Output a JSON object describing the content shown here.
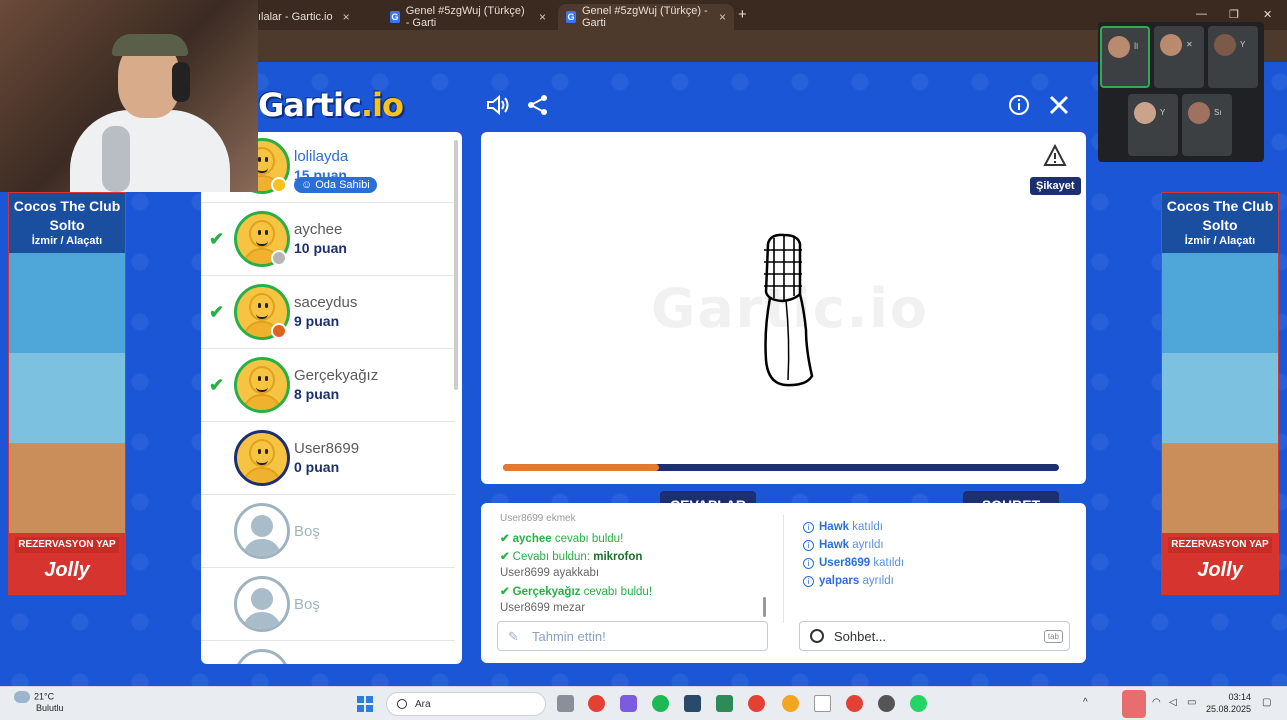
{
  "browser": {
    "tabs": [
      {
        "title": "ılalar - Gartic.io",
        "active": false
      },
      {
        "title": "Genel #5zgWuj (Türkçe) - Garti",
        "active": false
      },
      {
        "title": "Genel #5zgWuj (Türkçe) - Garti",
        "active": true
      }
    ],
    "new_tab": "+",
    "close_glyph": "×",
    "minimize": "—",
    "maximize": "❐",
    "close_window": "✕"
  },
  "header": {
    "logo_main": "Gartic",
    "logo_suffix": ".io",
    "sound_icon": "speaker-icon",
    "share_icon": "share-icon",
    "info_icon": "info-icon",
    "close_icon": "close-icon"
  },
  "players": [
    {
      "name": "lolilayda",
      "score": "15 puan",
      "badge": "Oda Sahibi",
      "guessed": false,
      "status_color": "#f7c21a",
      "style": "owner"
    },
    {
      "name": "aychee",
      "score": "10 puan",
      "guessed": true,
      "status_color": "#b5b5b5",
      "style": "normal"
    },
    {
      "name": "saceydus",
      "score": "9 puan",
      "guessed": true,
      "status_color": "#d9651e",
      "style": "normal"
    },
    {
      "name": "Gerçekyağız",
      "score": "8 puan",
      "guessed": true,
      "status_color": "",
      "style": "normal"
    },
    {
      "name": "User8699",
      "score": "0 puan",
      "guessed": false,
      "status_color": "",
      "style": "drawer"
    },
    {
      "name": "Boş",
      "score": "",
      "guessed": false,
      "status_color": "",
      "style": "empty"
    },
    {
      "name": "Boş",
      "score": "",
      "guessed": false,
      "status_color": "",
      "style": "empty"
    }
  ],
  "canvas": {
    "watermark": "Gartic.io",
    "report_icon": "warning-icon",
    "report_tooltip": "Şikayet",
    "progress": 0.28
  },
  "tabs": {
    "answers": "CEVAPLAR",
    "chat": "SOHBET"
  },
  "answers": [
    {
      "user": "User8699",
      "text": "ekmek"
    },
    {
      "user": "aychee",
      "text": "cevabı buldu!",
      "type": "found"
    },
    {
      "prefix": "Cevabı buldun:",
      "word": "mikrofon",
      "type": "you_found"
    },
    {
      "user": "User8699",
      "text": "ayakkabı"
    },
    {
      "user": "Gerçekyağız",
      "text": "cevabı buldu!",
      "type": "found"
    },
    {
      "user": "User8699",
      "text": "mezar"
    }
  ],
  "chat": [
    {
      "user": "Hawk",
      "action": "katıldı"
    },
    {
      "user": "Hawk",
      "action": "ayrıldı"
    },
    {
      "user": "User8699",
      "action": "katıldı"
    },
    {
      "user": "yalpars",
      "action": "ayrıldı"
    }
  ],
  "inputs": {
    "guess_placeholder": "Tahmin ettin!",
    "chat_placeholder": "Sohbet...",
    "chat_shortcut": "tab"
  },
  "ads": {
    "title": "Cocos The Club Solto",
    "location": "İzmir / Alaçatı",
    "cta": "REZERVASYON YAP",
    "brand": "Jolly"
  },
  "meet": {
    "tiles": [
      {
        "label": "İl"
      },
      {
        "label": ""
      },
      {
        "label": "Y"
      },
      {
        "label": "Y"
      },
      {
        "label": "Sı"
      }
    ]
  },
  "taskbar": {
    "temperature": "21°C",
    "weather": "Bulutlu",
    "search": "Ara",
    "time": "03:14",
    "date": "25.08.2025"
  },
  "colors": {
    "background": "#1a56d6",
    "navy": "#1c2f70",
    "green": "#27b045",
    "progress_fill": "#e8782a"
  }
}
